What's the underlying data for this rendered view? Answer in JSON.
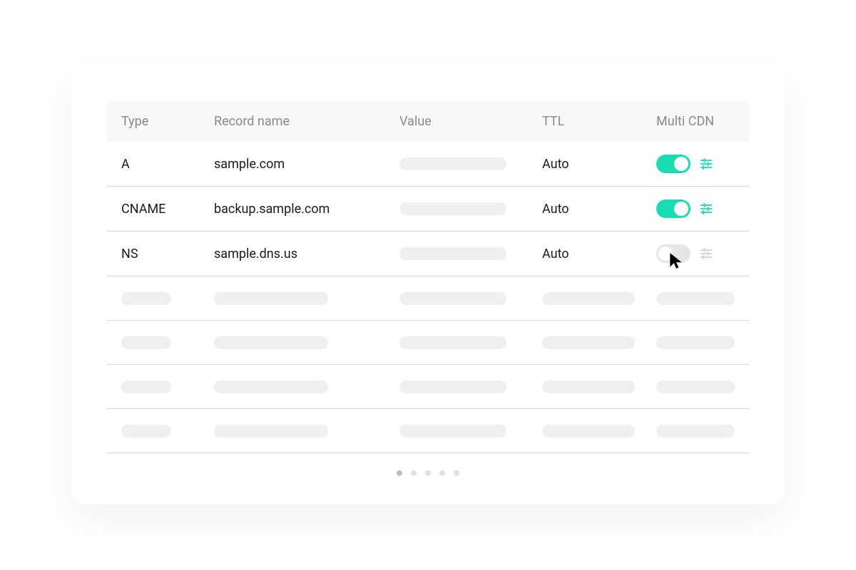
{
  "columns": {
    "type": "Type",
    "name": "Record name",
    "value": "Value",
    "ttl": "TTL",
    "cdn": "Multi CDN"
  },
  "rows": [
    {
      "type": "A",
      "name": "sample.com",
      "ttl": "Auto",
      "cdn_on": true
    },
    {
      "type": "CNAME",
      "name": "backup.sample.com",
      "ttl": "Auto",
      "cdn_on": true
    },
    {
      "type": "NS",
      "name": "sample.dns.us",
      "ttl": "Auto",
      "cdn_on": false
    }
  ],
  "placeholder_row_count": 4,
  "pager": {
    "count": 5,
    "active": 0
  },
  "colors": {
    "accent": "#1adcb2"
  }
}
